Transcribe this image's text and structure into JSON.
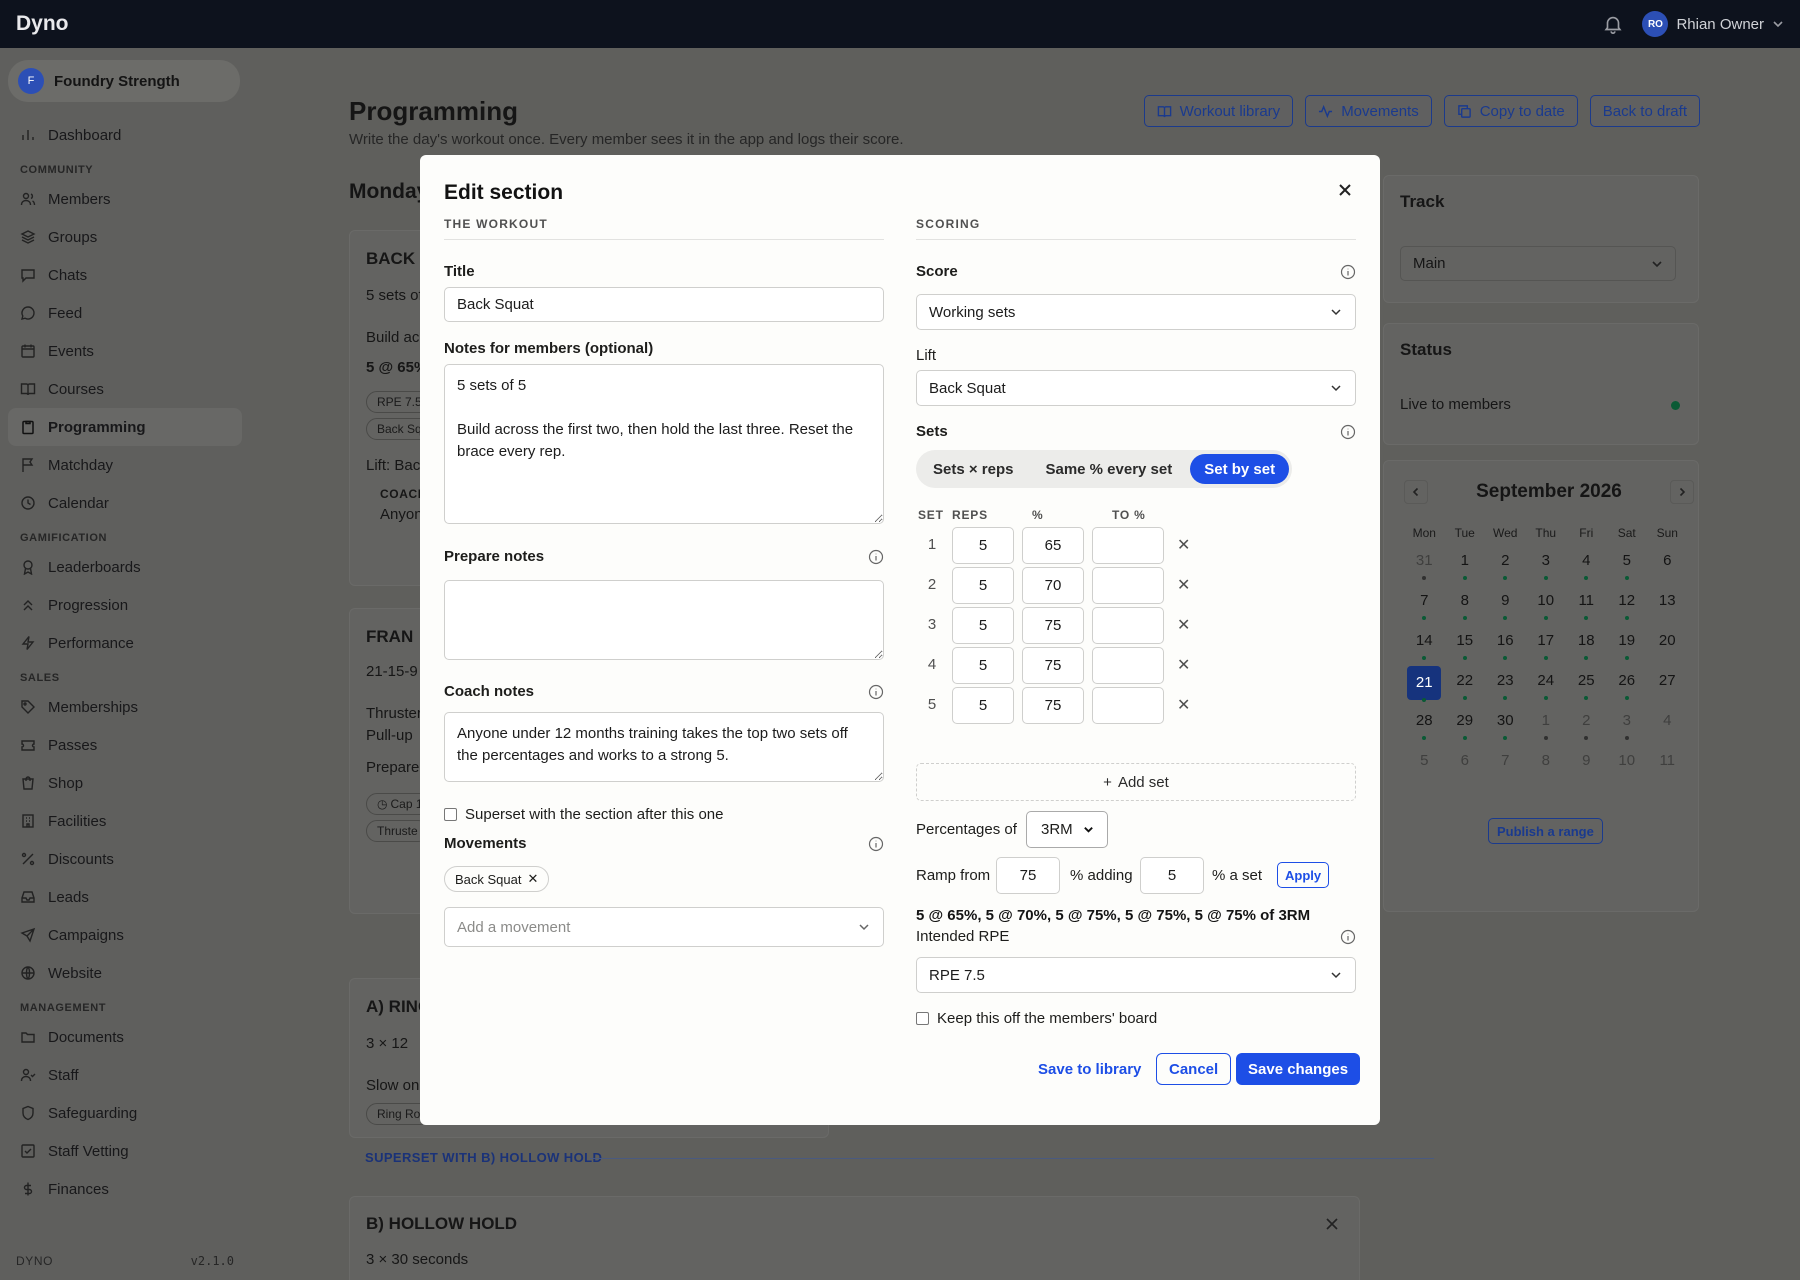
{
  "app": {
    "name": "Dyno",
    "user_name": "Rhian Owner",
    "user_initials": "RO"
  },
  "org": {
    "name": "Foundry Strength",
    "initial": "F"
  },
  "nav": {
    "dashboard": "Dashboard",
    "community_label": "COMMUNITY",
    "community": [
      "Members",
      "Groups",
      "Chats",
      "Feed",
      "Events",
      "Courses",
      "Programming",
      "Matchday",
      "Calendar"
    ],
    "gamification_label": "GAMIFICATION",
    "gamification": [
      "Leaderboards",
      "Progression",
      "Performance"
    ],
    "sales_label": "SALES",
    "sales": [
      "Memberships",
      "Passes",
      "Shop",
      "Facilities",
      "Discounts",
      "Leads",
      "Campaigns",
      "Website"
    ],
    "management_label": "MANAGEMENT",
    "management": [
      "Documents",
      "Staff",
      "Safeguarding",
      "Staff Vetting",
      "Finances"
    ],
    "footer_brand": "DYNO",
    "version": "v2.1.0"
  },
  "page": {
    "title": "Programming",
    "subtitle": "Write the day's workout once. Every member sees it in the app and logs their score.",
    "buttons": [
      "Workout library",
      "Movements",
      "Copy to date",
      "Back to draft"
    ],
    "day_title": "Monday"
  },
  "bg_cards": {
    "c1_title": "BACK S",
    "c1_sub": "5 sets of",
    "c1_build": "Build ac",
    "c1_bold": "5 @ 65%",
    "c1_pill1": "RPE 7.5",
    "c1_pill2": "Back Sq",
    "c1_lift": "Lift: Bac",
    "c1_coach": "COACH",
    "c1_anyone": "Anyon",
    "c2_title": "FRAN",
    "c2_sub": "21-15-9",
    "c2_l1": "Thruster",
    "c2_l2": "Pull-up",
    "c2_prep": "Prepare:",
    "c2_pill1": "Cap 1",
    "c2_pill2": "Thruste",
    "c3_title": "A) RING",
    "c3_sub": "3 × 12",
    "c3_slow": "Slow on",
    "c3_pill": "Ring Ro",
    "superset": "SUPERSET WITH B) HOLLOW HOLD",
    "c4_title": "B) HOLLOW HOLD",
    "c4_sub": "3 × 30 seconds"
  },
  "right": {
    "track_title": "Track",
    "track_value": "Main",
    "status_title": "Status",
    "status_value": "Live to members",
    "cal_month": "September 2026",
    "dow": [
      "Mon",
      "Tue",
      "Wed",
      "Thu",
      "Fri",
      "Sat",
      "Sun"
    ],
    "days": [
      {
        "d": "31",
        "m": true,
        "k": true
      },
      {
        "d": "1",
        "k": true
      },
      {
        "d": "2",
        "k": true
      },
      {
        "d": "3",
        "k": true
      },
      {
        "d": "4",
        "k": true
      },
      {
        "d": "5",
        "k": true
      },
      {
        "d": "6"
      },
      {
        "d": "7",
        "k": true
      },
      {
        "d": "8",
        "k": true
      },
      {
        "d": "9",
        "k": true
      },
      {
        "d": "10",
        "k": true
      },
      {
        "d": "11",
        "k": true
      },
      {
        "d": "12",
        "k": true
      },
      {
        "d": "13"
      },
      {
        "d": "14",
        "k": true
      },
      {
        "d": "15",
        "k": true
      },
      {
        "d": "16",
        "k": true
      },
      {
        "d": "17",
        "k": true
      },
      {
        "d": "18",
        "k": true
      },
      {
        "d": "19",
        "k": true
      },
      {
        "d": "20"
      },
      {
        "d": "21",
        "s": true,
        "k": true
      },
      {
        "d": "22",
        "k": true
      },
      {
        "d": "23",
        "k": true
      },
      {
        "d": "24",
        "k": true
      },
      {
        "d": "25",
        "k": true
      },
      {
        "d": "26",
        "k": true
      },
      {
        "d": "27"
      },
      {
        "d": "28",
        "k": true
      },
      {
        "d": "29",
        "k": true
      },
      {
        "d": "30",
        "k": true
      },
      {
        "d": "1",
        "m": true,
        "k": true
      },
      {
        "d": "2",
        "m": true,
        "k": true
      },
      {
        "d": "3",
        "m": true,
        "k": true
      },
      {
        "d": "4",
        "m": true
      },
      {
        "d": "5",
        "m": true
      },
      {
        "d": "6",
        "m": true
      },
      {
        "d": "7",
        "m": true
      },
      {
        "d": "8",
        "m": true
      },
      {
        "d": "9",
        "m": true
      },
      {
        "d": "10",
        "m": true
      },
      {
        "d": "11",
        "m": true
      }
    ],
    "publish": "Publish a range"
  },
  "modal": {
    "title": "Edit section",
    "workout_head": "THE WORKOUT",
    "scoring_head": "SCORING",
    "title_label": "Title",
    "title_value": "Back Squat",
    "notes_label": "Notes for members (optional)",
    "notes_value": "5 sets of 5\n\nBuild across the first two, then hold the last three. Reset the brace every rep.",
    "prepare_label": "Prepare notes",
    "prepare_value": "",
    "coach_label": "Coach notes",
    "coach_value": "Anyone under 12 months training takes the top two sets off the percentages and works to a strong 5.",
    "superset_label": "Superset with the section after this one",
    "movements_label": "Movements",
    "movement_chip": "Back Squat",
    "movement_placeholder": "Add a movement",
    "score_label": "Score",
    "score_value": "Working sets",
    "lift_label": "Lift",
    "lift_value": "Back Squat",
    "sets_label": "Sets",
    "sets_modes": [
      "Sets × reps",
      "Same % every set",
      "Set by set"
    ],
    "sets_mode_selected": 2,
    "col_set": "SET",
    "col_reps": "REPS",
    "col_pct": "%",
    "col_to": "TO %",
    "rows": [
      {
        "set": "1",
        "reps": "5",
        "pct": "65",
        "to": ""
      },
      {
        "set": "2",
        "reps": "5",
        "pct": "70",
        "to": ""
      },
      {
        "set": "3",
        "reps": "5",
        "pct": "75",
        "to": ""
      },
      {
        "set": "4",
        "reps": "5",
        "pct": "75",
        "to": ""
      },
      {
        "set": "5",
        "reps": "5",
        "pct": "75",
        "to": ""
      }
    ],
    "add_set": "Add set",
    "pct_of_label": "Percentages of",
    "pct_of_value": "3RM",
    "ramp_from_label": "Ramp from",
    "ramp_from_value": "75",
    "adding_label": "% adding",
    "adding_value": "5",
    "a_set_label": "% a set",
    "apply": "Apply",
    "summary": "5 @ 65%, 5 @ 70%, 5 @ 75%, 5 @ 75%, 5 @ 75% of 3RM",
    "rpe_label": "Intended RPE",
    "rpe_value": "RPE 7.5",
    "keep_off_label": "Keep this off the members' board",
    "save_library": "Save to library",
    "cancel": "Cancel",
    "save": "Save changes"
  }
}
